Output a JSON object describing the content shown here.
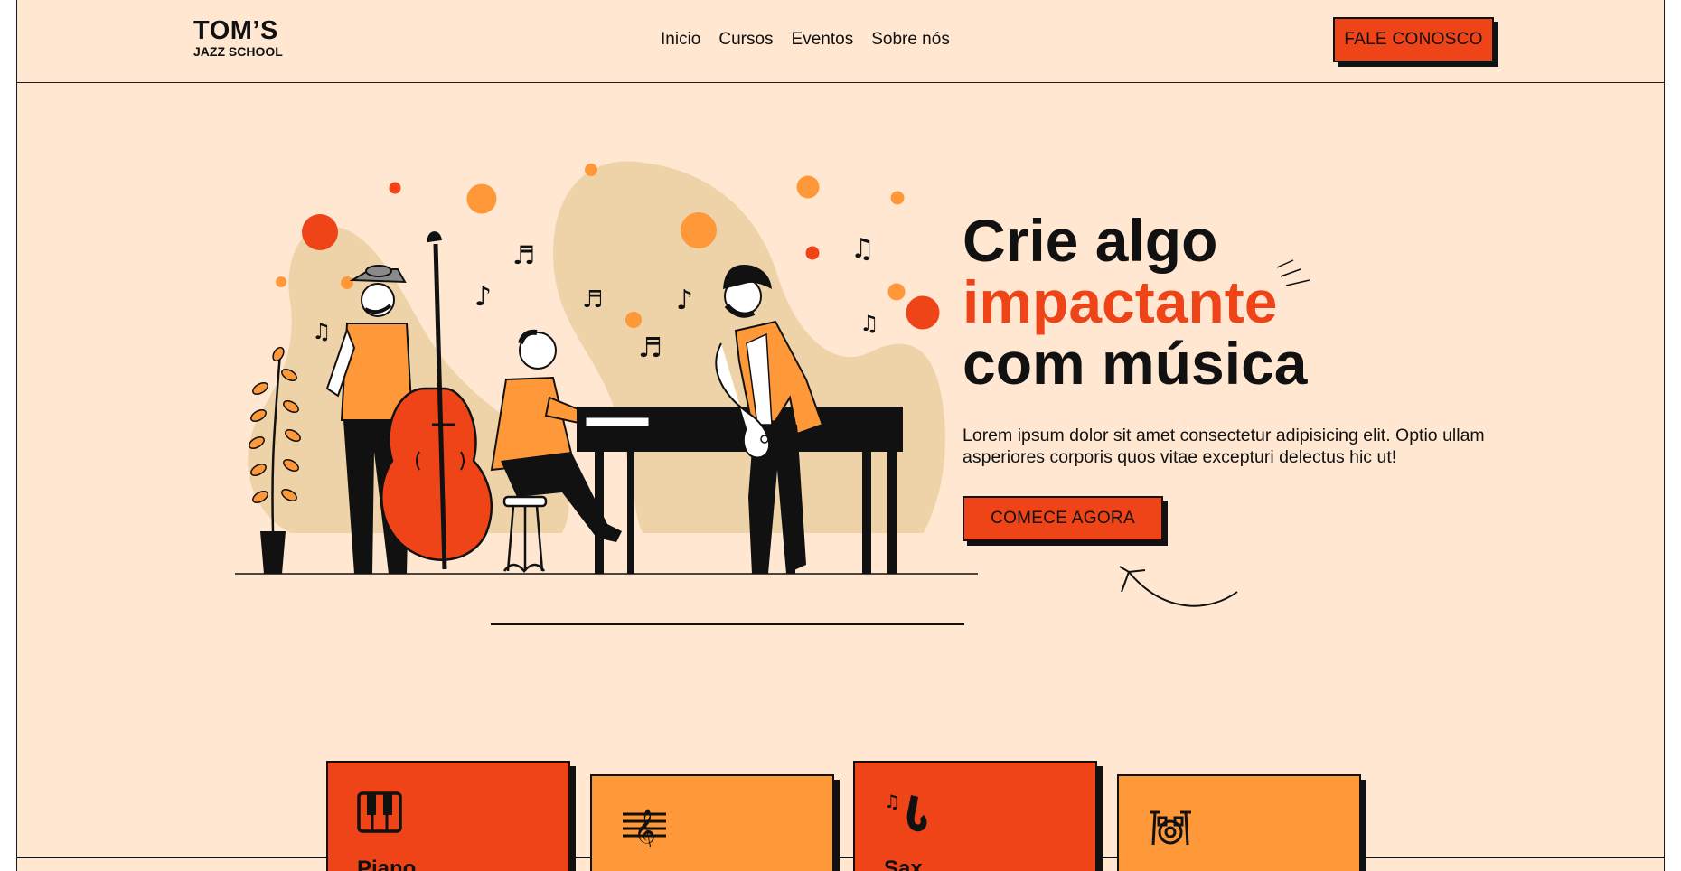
{
  "nav": {
    "logo_line1": "TOM’S",
    "logo_line2": "JAZZ SCHOOL",
    "items": [
      {
        "label": "Inicio"
      },
      {
        "label": "Cursos"
      },
      {
        "label": "Eventos"
      },
      {
        "label": "Sobre nós"
      }
    ],
    "cta_label": "FALE CONOSCO"
  },
  "hero": {
    "headline_1": "Crie algo",
    "headline_accent": "impactante",
    "headline_3": "com música",
    "description": "Lorem ipsum dolor sit amet consectetur adipisicing elit. Optio ullam asperiores corporis quos vitae excepturi delectus hic ut!",
    "button_label": "COMECE AGORA"
  },
  "courses": [
    {
      "title": "Piano",
      "icon": "piano-icon",
      "color": "#ef4318"
    },
    {
      "title": "",
      "icon": "music-sheet-icon",
      "color": "#fe9838"
    },
    {
      "title": "Sax",
      "icon": "saxophone-icon",
      "color": "#ef4318"
    },
    {
      "title": "",
      "icon": "drum-kit-icon",
      "color": "#fe9838"
    }
  ],
  "colors": {
    "background": "#ffe7d1",
    "accent_red": "#ef4318",
    "accent_orange": "#fe9838",
    "blob": "#efd3a8"
  }
}
